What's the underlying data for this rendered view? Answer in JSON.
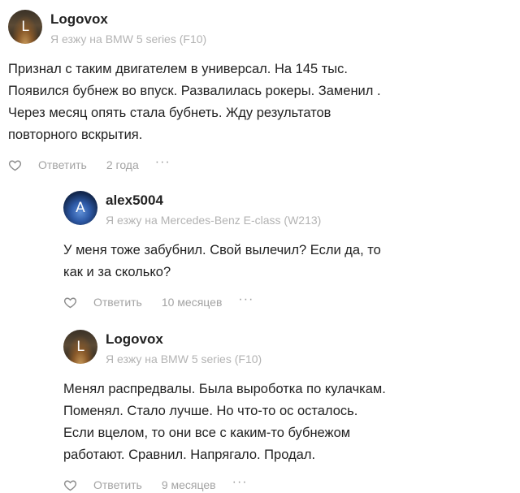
{
  "comments": [
    {
      "avatar_letter": "L",
      "username": "Logovox",
      "car": "Я езжу на BMW 5 series (F10)",
      "lines": [
        "Признал с таким двигателем в универсал. На 145 тыс.",
        "Появился бубнеж во впуск. Развалилась рокеры. Заменил .",
        "Через месяц опять стала бубнеть. Жду результатов",
        "повторного вскрытия."
      ],
      "reply_label": "Ответить",
      "age": "2 года",
      "more": "···"
    },
    {
      "avatar_letter": "A",
      "username": "alex5004",
      "car": "Я езжу на Mercedes-Benz E-class (W213)",
      "lines": [
        "У меня тоже забубнил. Свой вылечил? Если да, то",
        "как и за сколько?"
      ],
      "reply_label": "Ответить",
      "age": "10 месяцев",
      "more": "···"
    },
    {
      "avatar_letter": "L",
      "username": "Logovox",
      "car": "Я езжу на BMW 5 series (F10)",
      "lines": [
        "Менял распредвалы. Была выроботка по кулачкам.",
        "Поменял. Стало лучше. Но что-то ос осталось.",
        "Если вцелом, то они все с каким-то бубнежом",
        "работают. Сравнил. Напрягало. Продал."
      ],
      "reply_label": "Ответить",
      "age": "9 месяцев",
      "more": "···"
    }
  ],
  "colors": {
    "text": "#222222",
    "muted": "#a3a3a3",
    "car": "#b3b3b3"
  },
  "icons": {
    "like": "heart-icon",
    "more": "more-dots-icon"
  }
}
